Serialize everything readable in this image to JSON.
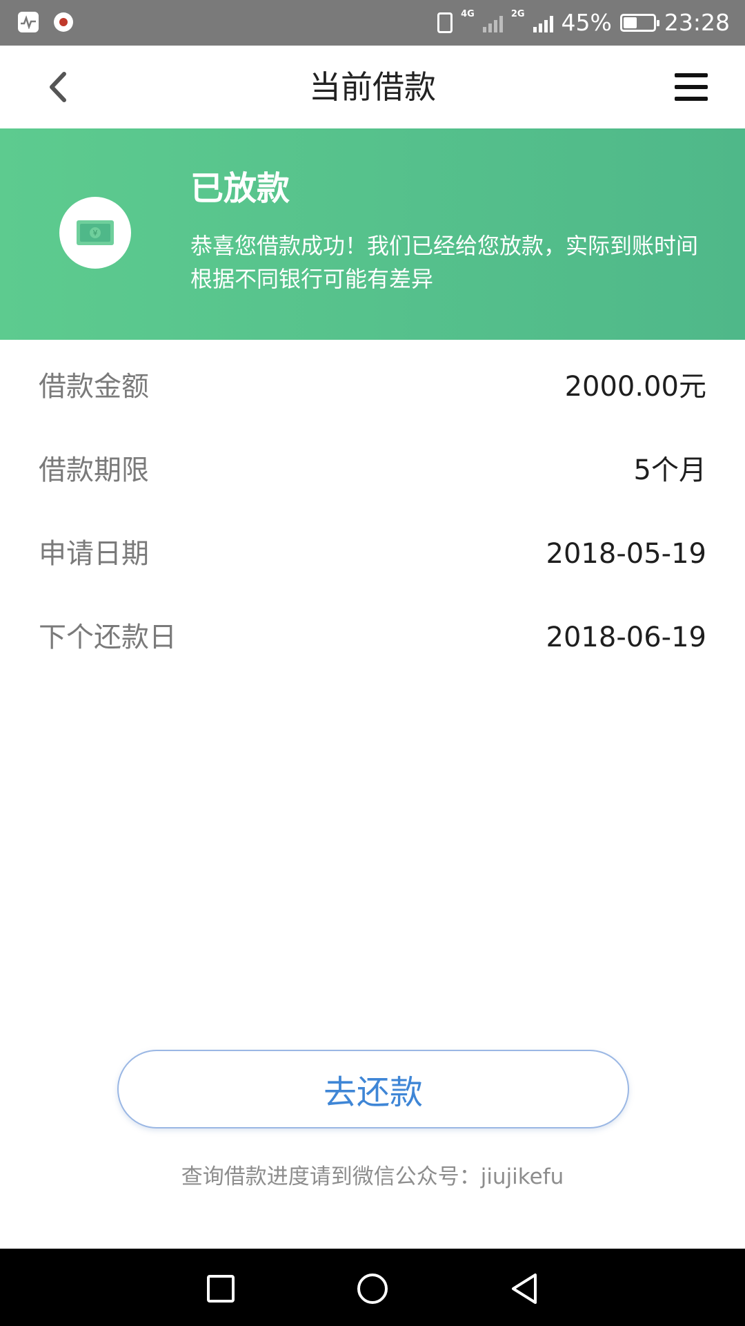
{
  "status_bar": {
    "network_labels": [
      "4G",
      "2G"
    ],
    "battery": "45%",
    "battery_level": 0.45,
    "time": "23:28"
  },
  "header": {
    "title": "当前借款",
    "icons": [
      "back-chevron-icon",
      "menu-icon"
    ]
  },
  "banner": {
    "title": "已放款",
    "description": "恭喜您借款成功！我们已经给您放款，实际到账时间根据不同银行可能有差异",
    "icon": "money-bill-icon",
    "gradient": [
      "#5dcb8f",
      "#4fb889"
    ]
  },
  "details": [
    {
      "label": "借款金额",
      "value": "2000.00元"
    },
    {
      "label": "借款期限",
      "value": "5个月"
    },
    {
      "label": "申请日期",
      "value": "2018-05-19"
    },
    {
      "label": "下个还款日",
      "value": "2018-06-19"
    }
  ],
  "actions": {
    "repay_label": "去还款"
  },
  "footer": {
    "note": "查询借款进度请到微信公众号：jiujikefu"
  },
  "colors": {
    "accent": "#3f86d6",
    "banner_green": "#55c08b",
    "label_gray": "#7a7a7a"
  },
  "nav_bar": {
    "icons": [
      "recent-apps-icon",
      "home-icon",
      "back-icon"
    ]
  }
}
